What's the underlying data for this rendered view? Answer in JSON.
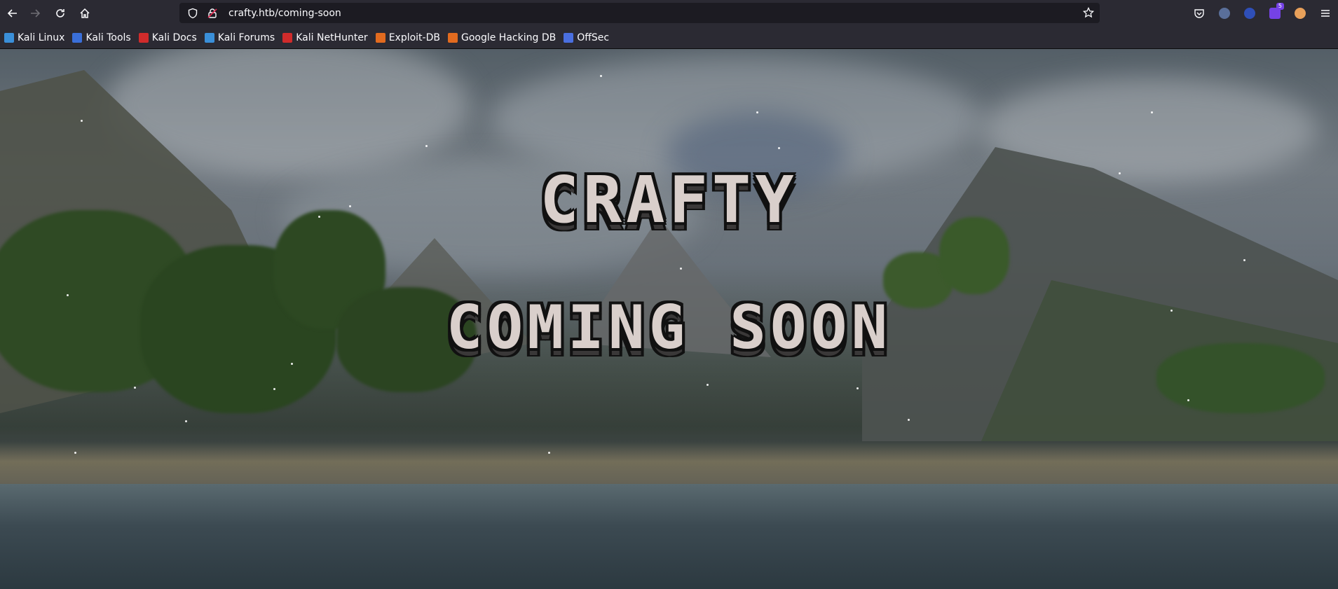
{
  "browser": {
    "url": "crafty.htb/coming-soon",
    "extension_badge": "5",
    "bookmarks": [
      {
        "label": "Kali Linux",
        "color": "#3a8fd9"
      },
      {
        "label": "Kali Tools",
        "color": "#3a6fd9"
      },
      {
        "label": "Kali Docs",
        "color": "#d02b2b"
      },
      {
        "label": "Kali Forums",
        "color": "#3a8fd9"
      },
      {
        "label": "Kali NetHunter",
        "color": "#d02b2b"
      },
      {
        "label": "Exploit-DB",
        "color": "#e26b1f"
      },
      {
        "label": "Google Hacking DB",
        "color": "#e26b1f"
      },
      {
        "label": "OffSec",
        "color": "#4a6fe0"
      }
    ]
  },
  "page": {
    "title": "CRAFTY",
    "subtitle": "COMING SOON"
  }
}
